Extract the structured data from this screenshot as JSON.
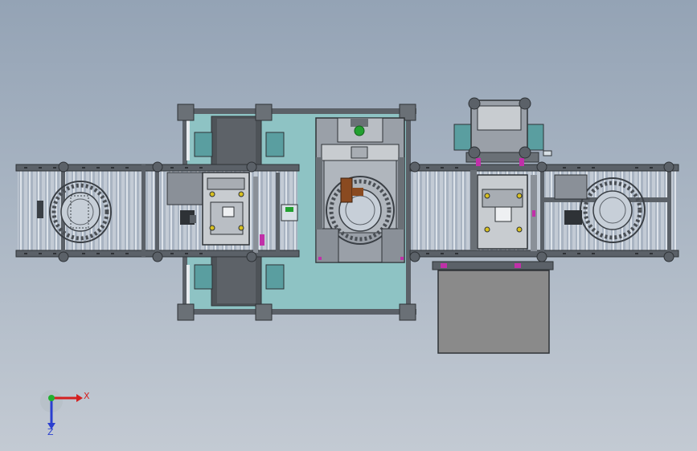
{
  "viewport": {
    "axes": {
      "x_label": "X",
      "z_label": "Z",
      "x_color": "#d42020",
      "z_color": "#2a3fd0",
      "y_color": "#22b030"
    }
  },
  "colors": {
    "frame": "#4a4f55",
    "frame_light": "#7a8088",
    "roller": "#aab5c3",
    "roller_shade": "#8794a6",
    "plate_teal": "#8ec3c4",
    "plate_dark": "#50555b",
    "block_grey": "#c8ccd0",
    "motor_teal": "#5a9ea0",
    "accent_magenta": "#c030a8",
    "accent_brown": "#8a4a20",
    "accent_green": "#22a030",
    "accent_yellow": "#d8c020",
    "cabinet": "#8a8a8a"
  }
}
